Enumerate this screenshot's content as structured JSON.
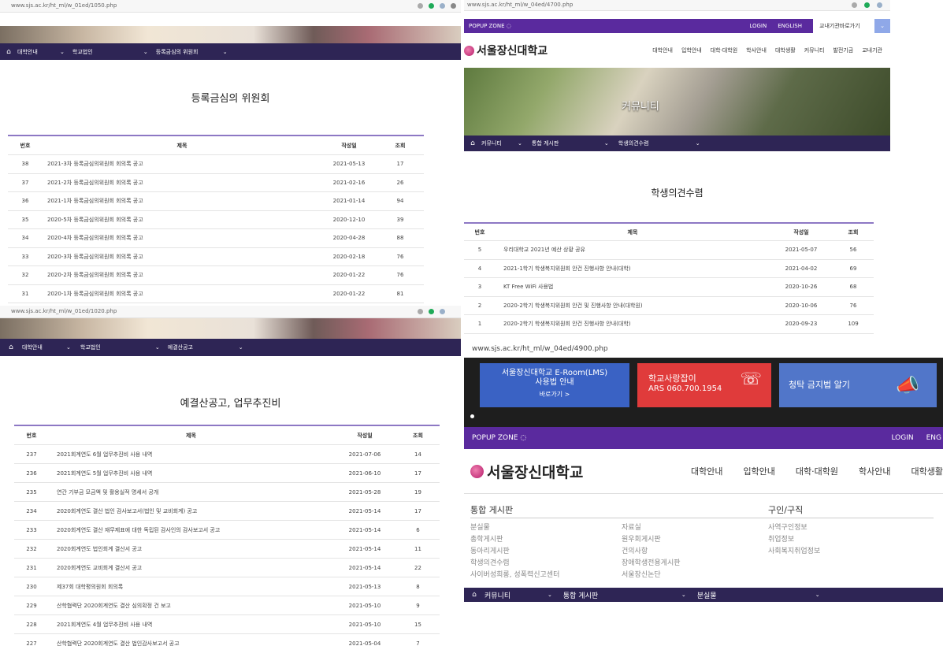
{
  "s1": {
    "url": "www.sjs.ac.kr/ht_ml/w_01ed/1050.php",
    "nav": [
      "대학안내",
      "학교법인",
      "등록금심의 위원회"
    ],
    "title": "등록금심의 위원회",
    "headers": {
      "num": "번호",
      "title": "제목",
      "date": "작성일",
      "views": "조회"
    },
    "rows": [
      {
        "num": "38",
        "title": "2021-3차 등록금심의위원회 회의록 공고",
        "date": "2021-05-13",
        "views": "17"
      },
      {
        "num": "37",
        "title": "2021-2차 등록금심의위원회 회의록 공고",
        "date": "2021-02-16",
        "views": "26"
      },
      {
        "num": "36",
        "title": "2021-1차 등록금심의위원회 회의록 공고",
        "date": "2021-01-14",
        "views": "94"
      },
      {
        "num": "35",
        "title": "2020-5차 등록금심의위원회 회의록 공고",
        "date": "2020-12-10",
        "views": "39"
      },
      {
        "num": "34",
        "title": "2020-4차 등록금심의위원회 회의록 공고",
        "date": "2020-04-28",
        "views": "88"
      },
      {
        "num": "33",
        "title": "2020-3차 등록금심의위원회 회의록 공고",
        "date": "2020-02-18",
        "views": "76"
      },
      {
        "num": "32",
        "title": "2020-2차 등록금심의위원회 회의록 공고",
        "date": "2020-01-22",
        "views": "76"
      },
      {
        "num": "31",
        "title": "2020-1차 등록금심의위원회 회의록 공고",
        "date": "2020-01-22",
        "views": "81"
      }
    ]
  },
  "s2": {
    "url": "www.sjs.ac.kr/ht_ml/w_04ed/4700.php",
    "popup_zone": "POPUP ZONE",
    "login": "LOGIN",
    "english": "ENGLISH",
    "quick_select": "교내기관바로가기",
    "logo": "서울장신대학교",
    "menu": [
      "대학안내",
      "입학안내",
      "대학·대학원",
      "학사안내",
      "대학생활",
      "커뮤니티",
      "발전기금",
      "교내기관"
    ],
    "banner_title": "커뮤니티",
    "nav": [
      "커뮤니티",
      "통합 게시판",
      "학생의견수렴"
    ],
    "title": "학생의견수렴",
    "headers": {
      "num": "번호",
      "title": "제목",
      "date": "작성일",
      "views": "조회"
    },
    "rows": [
      {
        "num": "5",
        "title": "우리대학교 2021년 예산 상황 공유",
        "date": "2021-05-07",
        "views": "56"
      },
      {
        "num": "4",
        "title": "2021-1학기 학생복지위원회 안건 진행사항 안내(대학)",
        "date": "2021-04-02",
        "views": "69"
      },
      {
        "num": "3",
        "title": "KT Free WiFi 사용법",
        "date": "2020-10-26",
        "views": "68"
      },
      {
        "num": "2",
        "title": "2020-2학기 학생복지위원회 안건 및 진행사항 안내(대학원)",
        "date": "2020-10-06",
        "views": "76"
      },
      {
        "num": "1",
        "title": "2020-2학기 학생복지위원회 안건 진행사항 안내(대학)",
        "date": "2020-09-23",
        "views": "109"
      }
    ]
  },
  "s3": {
    "url": "www.sjs.ac.kr/ht_ml/w_01ed/1020.php",
    "nav": [
      "대학안내",
      "학교법인",
      "예결산공고"
    ],
    "title": "예결산공고, 업무추진비",
    "headers": {
      "num": "번호",
      "title": "제목",
      "date": "작성일",
      "views": "조회"
    },
    "rows": [
      {
        "num": "237",
        "title": "2021회계연도 6월 업무추진비 사용 내역",
        "date": "2021-07-06",
        "views": "14"
      },
      {
        "num": "236",
        "title": "2021회계연도 5월 업무추진비 사용 내역",
        "date": "2021-06-10",
        "views": "17"
      },
      {
        "num": "235",
        "title": "연간 기부금 모금액 및 활용실적 명세서 공개",
        "date": "2021-05-28",
        "views": "19"
      },
      {
        "num": "234",
        "title": "2020회계연도 결산 법인 감사보고서(법인 및 교비회계) 공고",
        "date": "2021-05-14",
        "views": "17"
      },
      {
        "num": "233",
        "title": "2020회계연도 결산 재무제표에 대한 독립된 감사인의 감사보고서 공고",
        "date": "2021-05-14",
        "views": "6"
      },
      {
        "num": "232",
        "title": "2020회계연도 법인회계 결산서 공고",
        "date": "2021-05-14",
        "views": "11"
      },
      {
        "num": "231",
        "title": "2020회계연도 교비회계 결산서 공고",
        "date": "2021-05-14",
        "views": "22"
      },
      {
        "num": "230",
        "title": "제37회 대학평의원회 회의록",
        "date": "2021-05-13",
        "views": "8"
      },
      {
        "num": "229",
        "title": "산학협력단 2020회계연도 결산 심의확정 건 보고",
        "date": "2021-05-10",
        "views": "9"
      },
      {
        "num": "228",
        "title": "2021회계연도 4월 업무추진비 사용 내역",
        "date": "2021-05-10",
        "views": "15"
      },
      {
        "num": "227",
        "title": "산학협력단 2020회계연도 결산 법인감사보고서 공고",
        "date": "2021-05-04",
        "views": "7"
      }
    ]
  },
  "s4": {
    "url": "www.sjs.ac.kr/ht_ml/w_04ed/4900.php",
    "tile1_line1": "서울장신대학교 E-Room(LMS)",
    "tile1_line2": "사용법 안내",
    "tile1_link": "바로가기 >",
    "tile2_line1": "학교사랑잡이",
    "tile2_line2": "ARS 060.700.1954",
    "tile3": "청탁 금지법 알기",
    "popup_zone": "POPUP ZONE",
    "login": "LOGIN",
    "english": "ENG",
    "logo": "서울장신대학교",
    "menu": [
      "대학안내",
      "입학안내",
      "대학·대학원",
      "학사안내",
      "대학생활"
    ],
    "col1_title": "통합 게시판",
    "col1_left": [
      "분실물",
      "총학게시판",
      "동아리게시판",
      "학생의견수렴",
      "사이버성희롱, 성폭력신고센터"
    ],
    "col1_right": [
      "자료실",
      "원우회게시판",
      "건의사항",
      "장애학생전용게시판",
      "서울장신논단"
    ],
    "col2_title": "구인/구직",
    "col2_links": [
      "사역구인정보",
      "취업정보",
      "사회복지취업정보"
    ],
    "nav": [
      "커뮤니티",
      "통합 게시판",
      "분실물"
    ]
  }
}
